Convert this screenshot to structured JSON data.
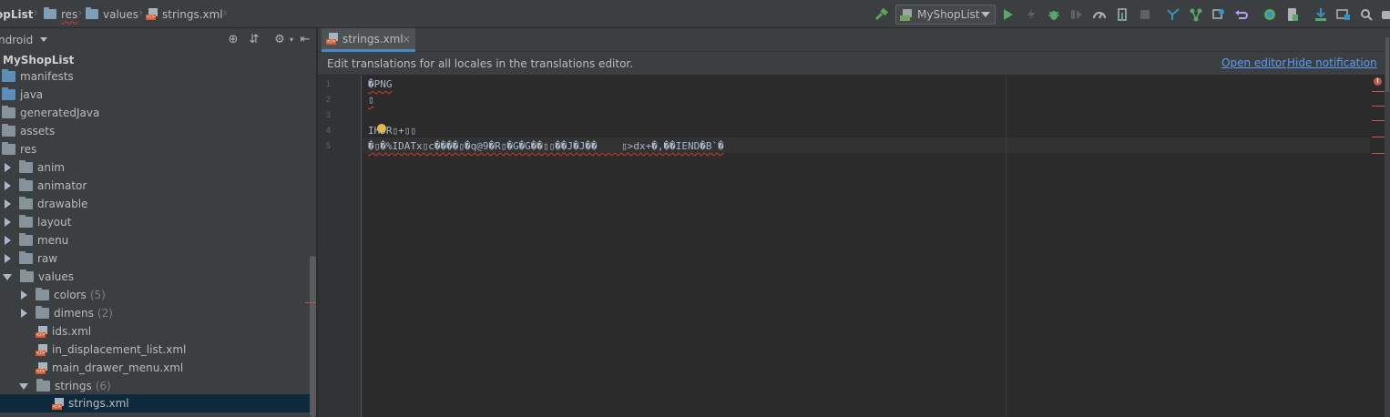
{
  "breadcrumbs": [
    {
      "label": "opList"
    },
    {
      "label": "res"
    },
    {
      "label": "values"
    },
    {
      "label": "strings.xml"
    }
  ],
  "toolbar": {
    "run_config": "MyShopList"
  },
  "project": {
    "view_mode": "ndroid",
    "root": "MyShopList",
    "items": [
      {
        "label": "manifests",
        "count": ""
      },
      {
        "label": "java",
        "count": ""
      },
      {
        "label": "generatedJava",
        "count": ""
      },
      {
        "label": "assets",
        "count": ""
      },
      {
        "label": "res",
        "count": ""
      },
      {
        "label": "anim",
        "count": ""
      },
      {
        "label": "animator",
        "count": ""
      },
      {
        "label": "drawable",
        "count": ""
      },
      {
        "label": "layout",
        "count": ""
      },
      {
        "label": "menu",
        "count": ""
      },
      {
        "label": "raw",
        "count": ""
      },
      {
        "label": "values",
        "count": ""
      },
      {
        "label": "colors",
        "count": "(5)"
      },
      {
        "label": "dimens",
        "count": "(2)"
      },
      {
        "label": "ids.xml",
        "count": ""
      },
      {
        "label": "in_displacement_list.xml",
        "count": ""
      },
      {
        "label": "main_drawer_menu.xml",
        "count": ""
      },
      {
        "label": "strings",
        "count": "(6)"
      },
      {
        "label": "strings.xml",
        "count": ""
      }
    ]
  },
  "editor": {
    "tab_label": "strings.xml",
    "tab_close": "×",
    "notification_text": "Edit translations for all locales in the translations editor.",
    "open_editor": "Open editor",
    "hide_notification": "Hide notification",
    "error_badge": "!",
    "line_numbers": [
      "1",
      "2",
      "3",
      "4",
      "5"
    ],
    "lines": [
      "�PNG",
      "▯",
      "",
      "IHDR▯+▯▯",
      "�▯�%IDATx▯c����▯�q@9�R▯�G�G��▯▯��J�J��    ▯>dx+�,��IEND�B`�"
    ]
  }
}
